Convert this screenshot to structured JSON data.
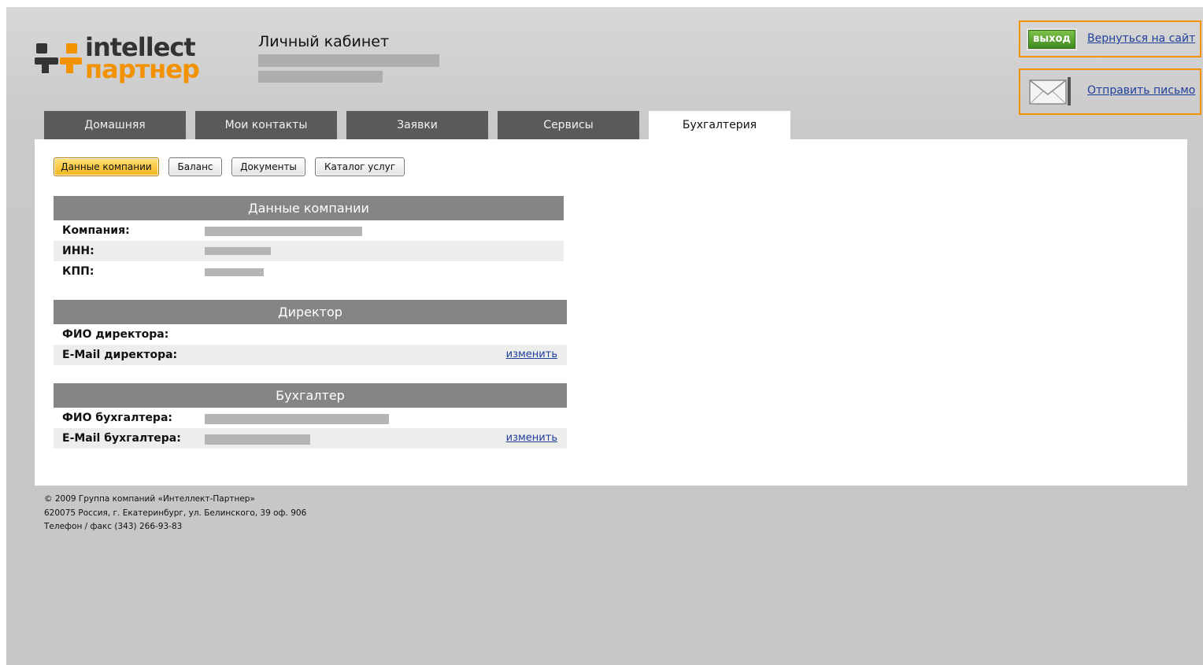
{
  "logo": {
    "word1": "intellect",
    "word2": "партнер"
  },
  "header": {
    "title": "Личный кабинет"
  },
  "top_right": {
    "exit_label": "выход",
    "back_link": "Вернуться на сайт",
    "send_link": "Отправить письмо"
  },
  "tabs": [
    {
      "label": "Домашняя",
      "active": false
    },
    {
      "label": "Мои контакты",
      "active": false
    },
    {
      "label": "Заявки",
      "active": false
    },
    {
      "label": "Сервисы",
      "active": false
    },
    {
      "label": "Бухгалтерия",
      "active": true
    }
  ],
  "subnav": [
    {
      "label": "Данные компании",
      "active": true
    },
    {
      "label": "Баланс",
      "active": false
    },
    {
      "label": "Документы",
      "active": false
    },
    {
      "label": "Каталог услуг",
      "active": false
    }
  ],
  "company": {
    "heading": "Данные компании",
    "rows": [
      "Компания:",
      "ИНН:",
      "КПП:"
    ]
  },
  "director": {
    "heading": "Директор",
    "rows": [
      "ФИО директора:",
      "E-Mail директора:"
    ],
    "edit_label": "изменить"
  },
  "accountant": {
    "heading": "Бухгалтер",
    "rows": [
      "ФИО бухгалтера:",
      "E-Mail бухгалтера:"
    ],
    "edit_label": "изменить"
  },
  "footer": {
    "line1": "© 2009 Группа компаний «Интеллект-Партнер»",
    "line2": "620075 Россия, г. Екатеринбург, ул. Белинского, 39 оф. 906",
    "line3": "Телефон / факс (343) 266-93-83"
  }
}
